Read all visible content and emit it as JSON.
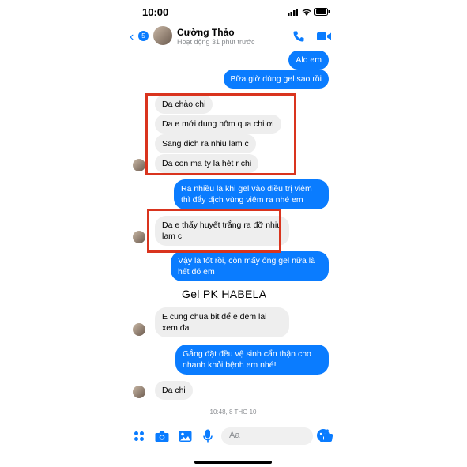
{
  "status": {
    "time": "10:00"
  },
  "header": {
    "name": "Cường Thảo",
    "activity": "Hoạt động 31 phút trước",
    "badge": "5"
  },
  "messages": [
    {
      "dir": "out",
      "text": "Alo em"
    },
    {
      "dir": "out",
      "text": "Bữa giờ dùng gel sao rồi"
    },
    {
      "dir": "in",
      "text": "Da chào chi"
    },
    {
      "dir": "in",
      "text": "Da e mới dung hôm qua chi ơi"
    },
    {
      "dir": "in",
      "text": "Sang dich ra nhiu lam c"
    },
    {
      "dir": "in",
      "text": "Da con ma ty la hét r chi"
    },
    {
      "dir": "out",
      "text": "Ra nhiều là khi gel vào điều trị viêm thì đẩy dịch vùng viêm ra nhé em"
    },
    {
      "dir": "in",
      "text": "Da e thấy huyết trắng ra đỡ nhiu lam c"
    },
    {
      "dir": "out",
      "text": "Vậy là tốt rồi, còn mấy ống gel nữa là hết đó em"
    },
    {
      "dir": "in",
      "text": "E cung chua bit để e đem lai xem đa"
    },
    {
      "dir": "out",
      "text": "Gắng đặt đều vệ sinh cẩn thận cho nhanh khỏi bệnh em nhé!"
    },
    {
      "dir": "in",
      "text": "Da chi"
    }
  ],
  "caption": "Gel PK HABELA",
  "timestamp": "10:48, 8 THG 10",
  "composer": {
    "placeholder": "Aa"
  },
  "colors": {
    "accent": "#0a7cff",
    "incoming": "#eeeeee",
    "highlight": "#d9341e"
  },
  "icons": [
    "back-chevron-icon",
    "phone-icon",
    "video-icon",
    "apps-icon",
    "camera-icon",
    "image-icon",
    "mic-icon",
    "emoji-icon",
    "like-icon"
  ]
}
